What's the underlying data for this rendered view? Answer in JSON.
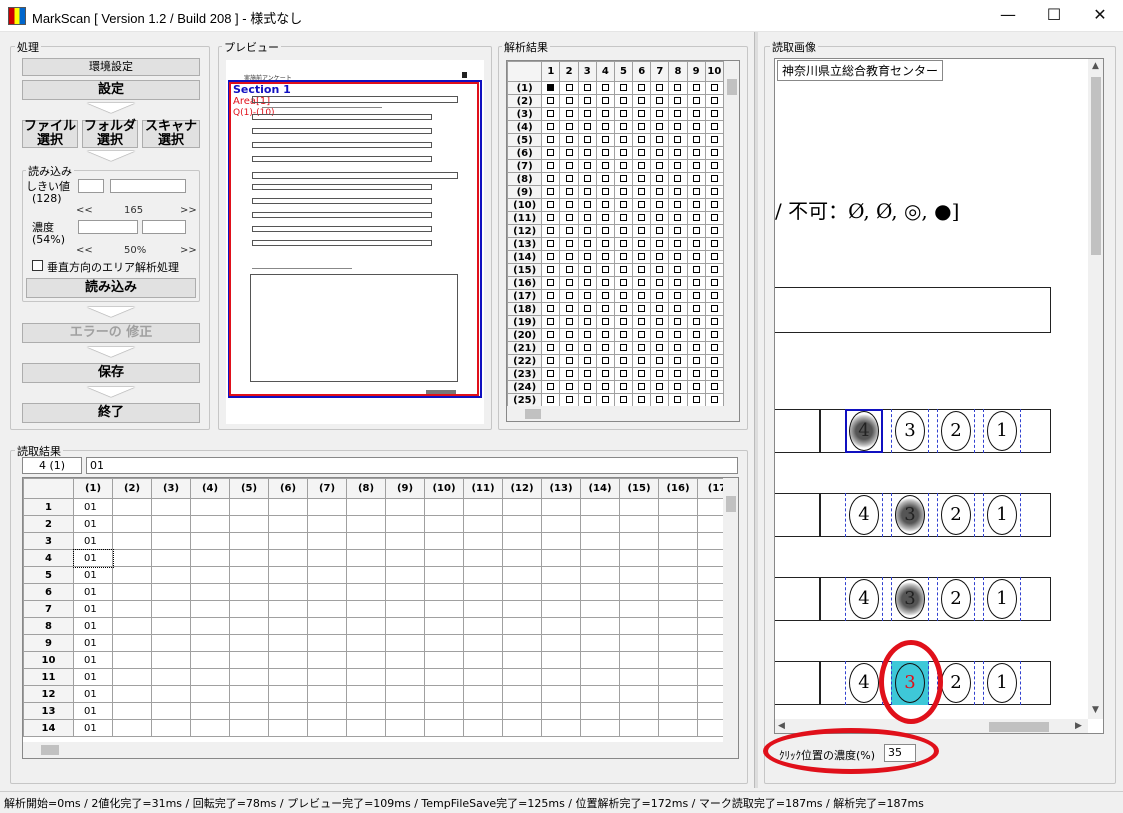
{
  "window": {
    "title": "MarkScan [ Version 1.2 / Build 208 ] - 様式なし",
    "minimize": "—",
    "maximize": "☐",
    "close": "✕"
  },
  "process": {
    "label": "処理",
    "env_settings": "環境設定",
    "settings": "設定",
    "file_select": "ファイル\n選択",
    "folder_select": "フォルダ\n選択",
    "scanner_select": "スキャナ\n選択",
    "read_group": "読み込み",
    "threshold_label": "しきい値",
    "threshold_default": "(128)",
    "threshold_ticks": "165",
    "density_label": "濃度",
    "density_default": "(54%)",
    "density_ticks": "50%",
    "slider_left": "<<",
    "slider_right": ">>",
    "vertical_area": "垂直方向のエリア解析処理",
    "read_button": "読み込み",
    "error_fix": "エラーの 修正",
    "save": "保存",
    "exit": "終了"
  },
  "preview": {
    "label": "プレビュー",
    "section": "Section 1",
    "area": "Area[1]",
    "questions": "Q(1)-(10)",
    "form_heading": "実施前アンケート"
  },
  "analysis": {
    "label": "解析結果",
    "columns": [
      "1",
      "2",
      "3",
      "4",
      "5",
      "6",
      "7",
      "8",
      "9",
      "10"
    ],
    "rows": [
      "(1)",
      "(2)",
      "(3)",
      "(4)",
      "(5)",
      "(6)",
      "(7)",
      "(8)",
      "(9)",
      "(10)",
      "(11)",
      "(12)",
      "(13)",
      "(14)",
      "(15)",
      "(16)",
      "(17)",
      "(18)",
      "(19)",
      "(20)",
      "(21)",
      "(22)",
      "(23)",
      "(24)",
      "(25)"
    ]
  },
  "results": {
    "label": "読取結果",
    "cell_ref": "4 (1)",
    "cell_value": "01",
    "columns": [
      "(1)",
      "(2)",
      "(3)",
      "(4)",
      "(5)",
      "(6)",
      "(7)",
      "(8)",
      "(9)",
      "(10)",
      "(11)",
      "(12)",
      "(13)",
      "(14)",
      "(15)",
      "(16)",
      "(17"
    ],
    "rows": [
      {
        "n": "1",
        "v": "01"
      },
      {
        "n": "2",
        "v": "01"
      },
      {
        "n": "3",
        "v": "01"
      },
      {
        "n": "4",
        "v": "01"
      },
      {
        "n": "5",
        "v": "01"
      },
      {
        "n": "6",
        "v": "01"
      },
      {
        "n": "7",
        "v": "01"
      },
      {
        "n": "8",
        "v": "01"
      },
      {
        "n": "9",
        "v": "01"
      },
      {
        "n": "10",
        "v": "01"
      },
      {
        "n": "11",
        "v": "01"
      },
      {
        "n": "12",
        "v": "01"
      },
      {
        "n": "13",
        "v": "01"
      },
      {
        "n": "14",
        "v": "01"
      }
    ]
  },
  "scan": {
    "label": "読取画像",
    "institution": "神奈川県立総合教育センター",
    "header_text": "/ 不可：Ø, Ø, ◎, ●]",
    "rows": [
      [
        "4",
        "3",
        "2",
        "1"
      ],
      [
        "4",
        "3",
        "2",
        "1"
      ],
      [
        "4",
        "3",
        "2",
        "1"
      ],
      [
        "4",
        "3",
        "2",
        "1"
      ]
    ],
    "click_density_label": "ｸﾘｯｸ位置の濃度(%)",
    "click_density_value": "35"
  },
  "status": "解析開始=0ms / 2値化完了=31ms / 回転完了=78ms / プレビュー完了=109ms / TempFileSave完了=125ms / 位置解析完了=172ms / マーク読取完了=187ms / 解析完了=187ms",
  "colors": {
    "highlight": "#3ec8d8",
    "annotation_red": "#e0101a",
    "section_blue": "#1010c0"
  }
}
